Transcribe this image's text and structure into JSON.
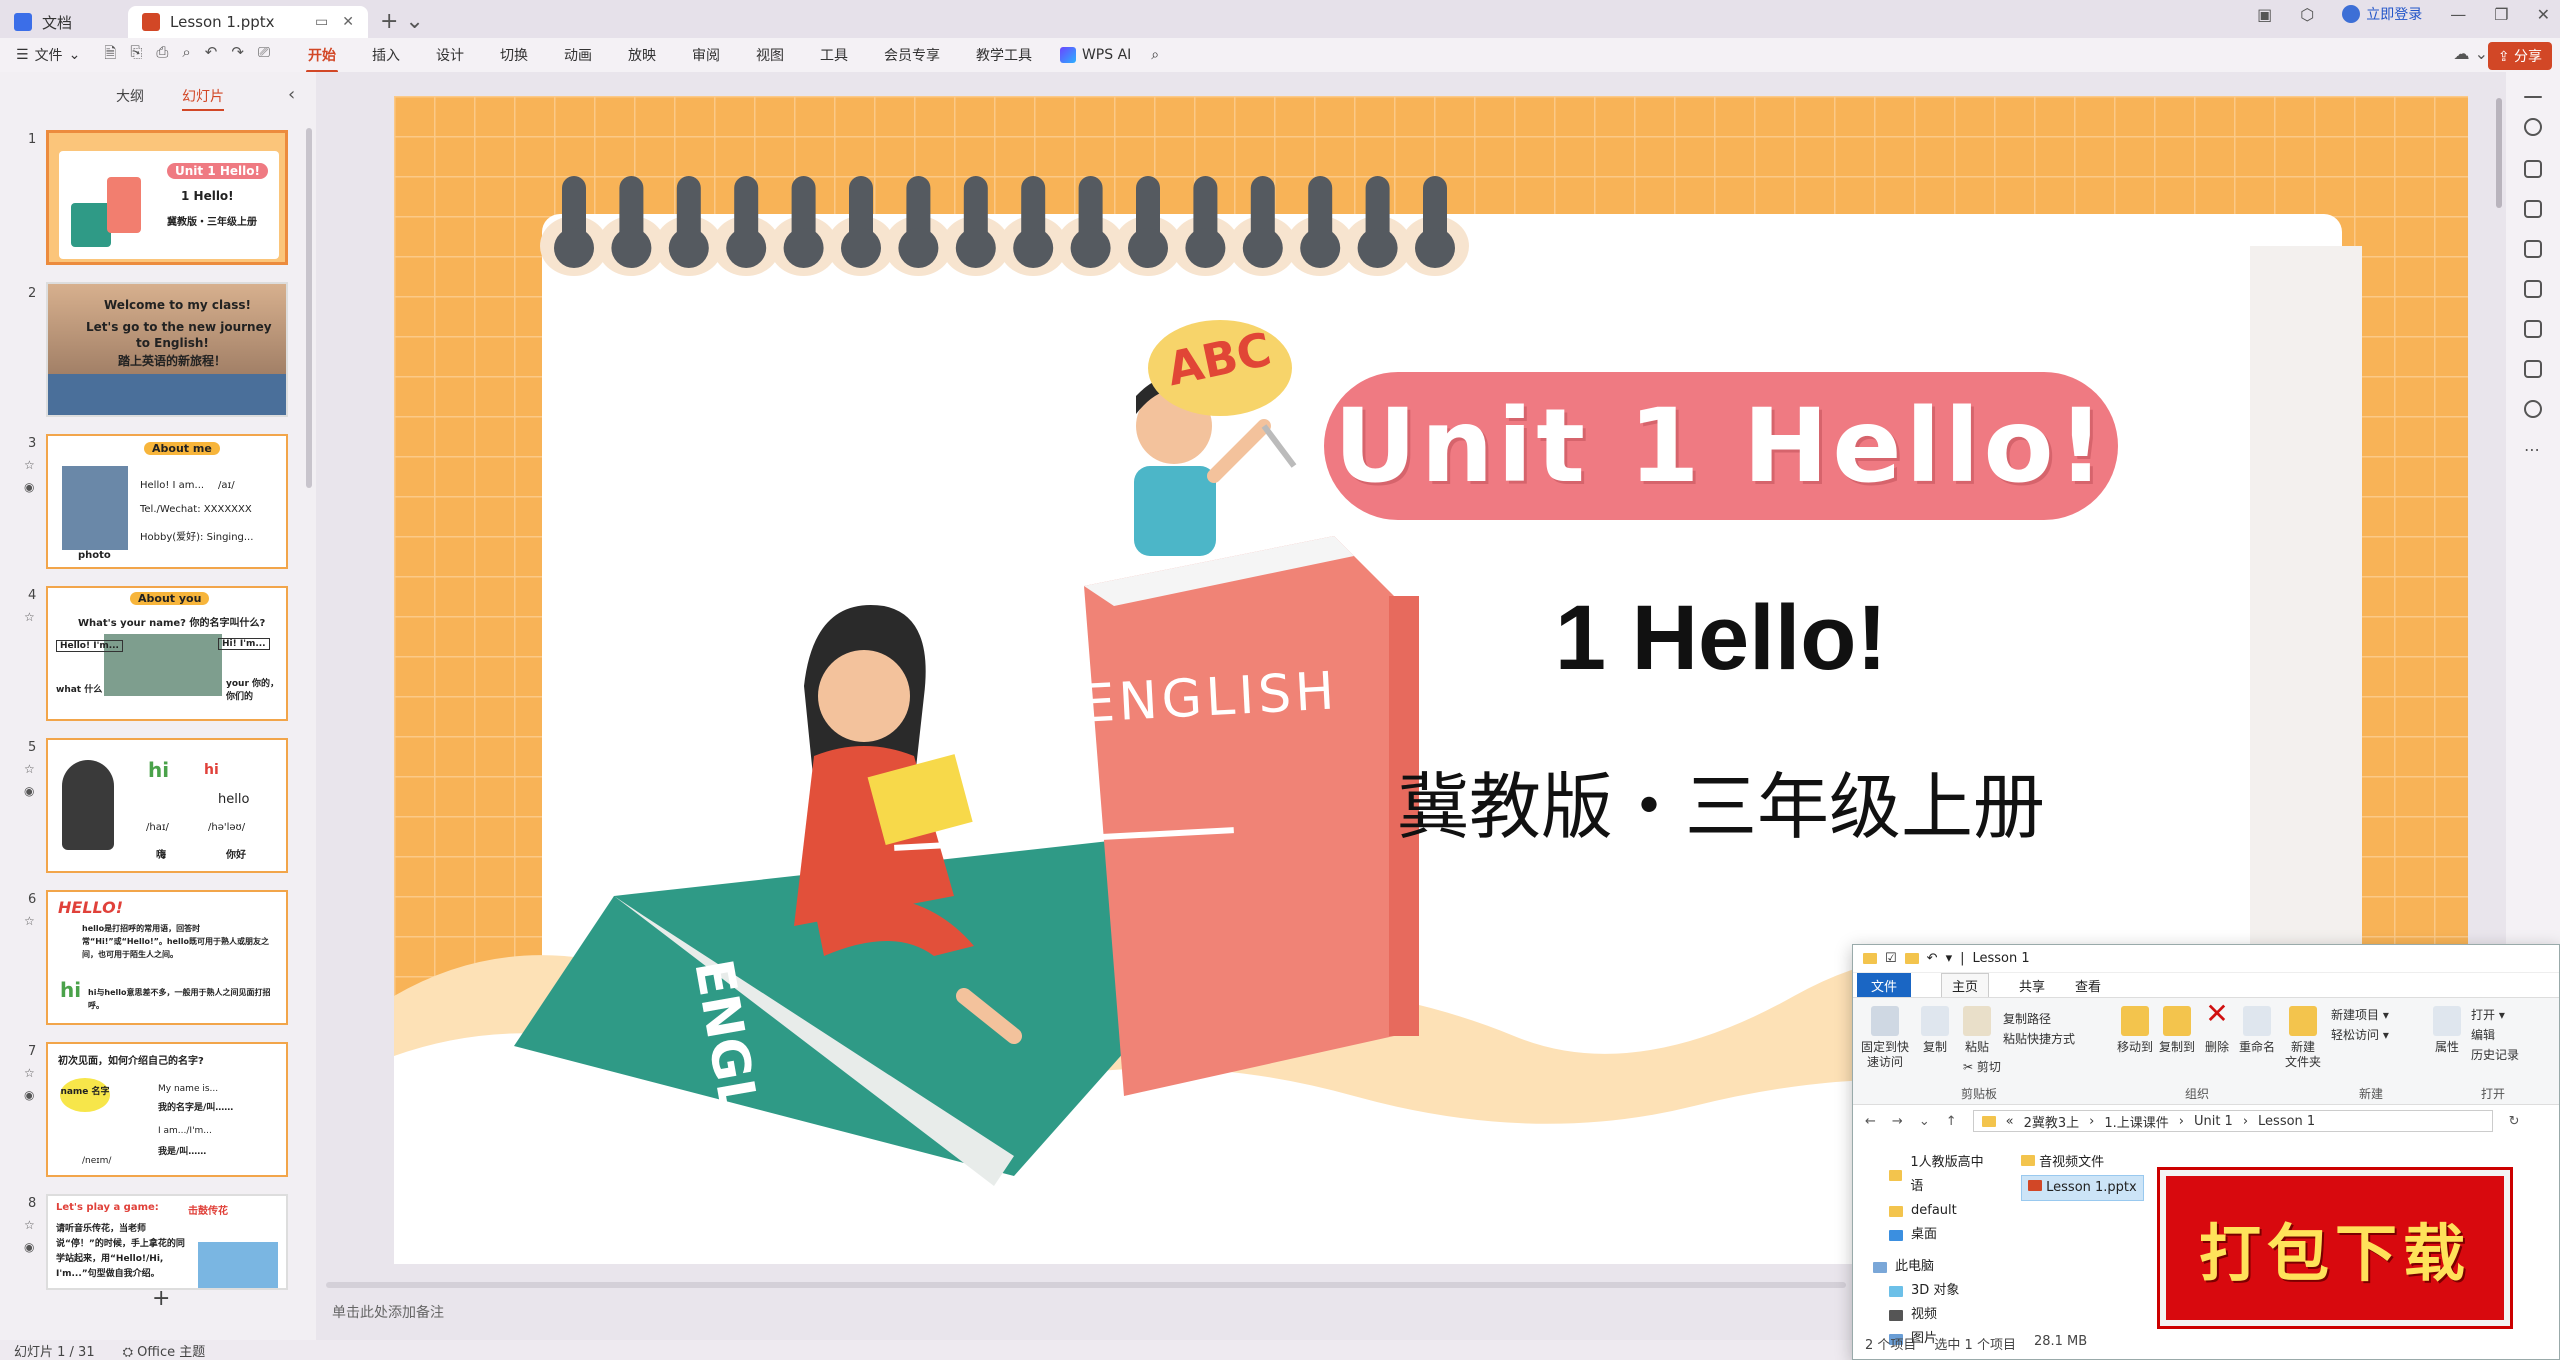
{
  "titlebar": {
    "tabs": [
      {
        "label": "文档"
      },
      {
        "label": "Lesson 1.pptx"
      }
    ],
    "login_label": "立即登录"
  },
  "menubar": {
    "file_label": "文件",
    "tabs": [
      "开始",
      "插入",
      "设计",
      "切换",
      "动画",
      "放映",
      "审阅",
      "视图",
      "工具",
      "会员专享",
      "教学工具"
    ],
    "active_tab": "开始",
    "wps_ai": "WPS AI",
    "share_label": "分享"
  },
  "leftpanel": {
    "tabs": [
      "大纲",
      "幻灯片"
    ],
    "active_tab": "幻灯片",
    "slides": [
      {
        "num": "1",
        "t1": "Unit 1 Hello!",
        "t2": "1 Hello!",
        "t3": "冀教版・三年级上册"
      },
      {
        "num": "2",
        "t1": "Welcome to my class!",
        "t2": "Let's go to the new journey",
        "t3": "to English!",
        "t4": "踏上英语的新旅程！"
      },
      {
        "num": "3",
        "t1": "About me",
        "t2": "Hello! I am...",
        "t3": "Tel./Wechat: XXXXXXX",
        "t4": "Hobby(爱好): Singing...",
        "t5": "photo",
        "t6": "/aɪ/"
      },
      {
        "num": "4",
        "t1": "About you",
        "t2": "What's your name? 你的名字叫什么?",
        "t3": "Hello! I'm...",
        "t4": "Hi! I'm...",
        "t5": "what 什么",
        "t6": "your 你的，你们的"
      },
      {
        "num": "5",
        "t1": "hi",
        "t2": "hello",
        "t3": "/haɪ/",
        "t4": "/hə'ləʊ/",
        "t5": "嗨",
        "t6": "你好"
      },
      {
        "num": "6",
        "t1": "HELLO!",
        "t2": "hello是打招呼的常用语，回答时常“Hi!”或“Hello!”。hello既可用于熟人或朋友之间，也可用于陌生人之间。",
        "t3": "hi",
        "t4": "hi与hello意思差不多，一般用于熟人之间见面打招呼。"
      },
      {
        "num": "7",
        "t1": "初次见面，如何介绍自己的名字?",
        "t2": "name 名字",
        "t3": "My name is...",
        "t4": "我的名字是/叫……",
        "t5": "I am.../I'm...",
        "t6": "我是/叫……",
        "t7": "/neɪm/"
      },
      {
        "num": "8",
        "t1": "Let's play a game:",
        "t2": "击鼓传花",
        "t3": "请听音乐传花，当老师说“停！”的时候，手上拿花的同学站起来，用“Hello!/Hi, I'm...”句型做自我介绍。"
      }
    ],
    "add_label": "+"
  },
  "slide": {
    "title": "Unit 1 Hello!",
    "subtitle": "1  Hello!",
    "edition": "冀教版・三年级上册",
    "abc_sign": "ABC",
    "book_label": "ENGLISH",
    "book_label_2": "ENGLISH"
  },
  "notes_placeholder": "单击此处添加备注",
  "statusbar": {
    "slide_count": "幻灯片 1 / 31",
    "theme": "Office 主题"
  },
  "explorer": {
    "title": "Lesson 1",
    "tabs": [
      "文件",
      "主页",
      "共享",
      "查看"
    ],
    "ribbon": {
      "pin": "固定到快\n速访问",
      "copy": "复制",
      "paste": "粘贴",
      "copy_path": "复制路径",
      "paste_shortcut": "粘贴快捷方式",
      "cut": "剪切",
      "clipboard": "剪贴板",
      "move_to": "移动到",
      "copy_to": "复制到",
      "delete": "删除",
      "rename": "重命名",
      "organize": "组织",
      "new_folder": "新建\n文件夹",
      "new_item": "新建项目",
      "easy_access": "轻松访问",
      "new": "新建",
      "properties": "属性",
      "open": "打开",
      "edit": "编辑",
      "history": "历史记录",
      "open_group": "打开"
    },
    "path": [
      "«",
      "2冀教3上",
      "1.上课课件",
      "Unit 1",
      "Lesson 1"
    ],
    "nav": [
      "1人教版高中语",
      "default",
      "桌面",
      "此电脑",
      "3D 对象",
      "视频",
      "图片"
    ],
    "files": [
      "音视频文件",
      "Lesson 1.pptx"
    ],
    "status": [
      "2 个项目",
      "选中 1 个项目",
      "28.1 MB"
    ]
  },
  "download_badge": "打包下载",
  "colors": {
    "accent": "#d24726",
    "slide_bg": "#f8b357",
    "title_pill": "#ef7a82"
  }
}
